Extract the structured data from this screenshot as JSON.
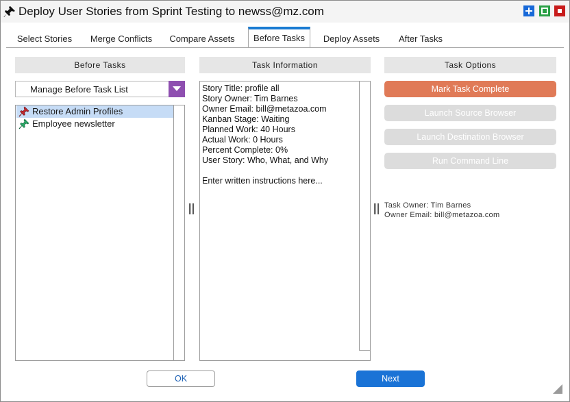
{
  "window": {
    "title": "Deploy User Stories from Sprint Testing to newss@mz.com",
    "pin_icon": "pushpin-icon",
    "controls": [
      "add-icon",
      "maximize-icon",
      "close-icon"
    ]
  },
  "tabs": [
    {
      "label": "Select Stories",
      "active": false
    },
    {
      "label": "Merge Conflicts",
      "active": false
    },
    {
      "label": "Compare Assets",
      "active": false
    },
    {
      "label": "Before Tasks",
      "active": true
    },
    {
      "label": "Deploy Assets",
      "active": false
    },
    {
      "label": "After Tasks",
      "active": false
    }
  ],
  "before_tasks": {
    "header": "Before Tasks",
    "dropdown_label": "Manage Before Task List",
    "items": [
      {
        "label": "Restore Admin Profiles",
        "selected": true,
        "icon": "red-pushpin-icon"
      },
      {
        "label": "Employee newsletter",
        "selected": false,
        "icon": "green-pushpin-icon"
      }
    ]
  },
  "task_information": {
    "header": "Task Information",
    "lines": [
      "Story Title: profile all",
      "Story Owner: Tim Barnes",
      "Owner Email: bill@metazoa.com",
      "Kanban Stage: Waiting",
      "Planned Work: 40 Hours",
      "Actual Work: 0 Hours",
      "Percent Complete: 0%",
      "User Story: Who, What, and Why",
      "",
      "Enter written instructions here..."
    ]
  },
  "task_options": {
    "header": "Task Options",
    "mark_complete": "Mark Task Complete",
    "launch_source": "Launch Source Browser",
    "launch_destination": "Launch Destination Browser",
    "run_command": "Run Command Line",
    "task_owner": "Task Owner: Tim Barnes",
    "owner_email": "Owner Email: bill@metazoa.com"
  },
  "footer": {
    "ok": "OK",
    "next": "Next"
  },
  "colors": {
    "accent_tab": "#1a7bd2",
    "primary_button": "#e07a57",
    "next_button": "#1a73d6",
    "dropdown_arrow": "#8e4fb0",
    "selection": "#c6dcf6"
  }
}
